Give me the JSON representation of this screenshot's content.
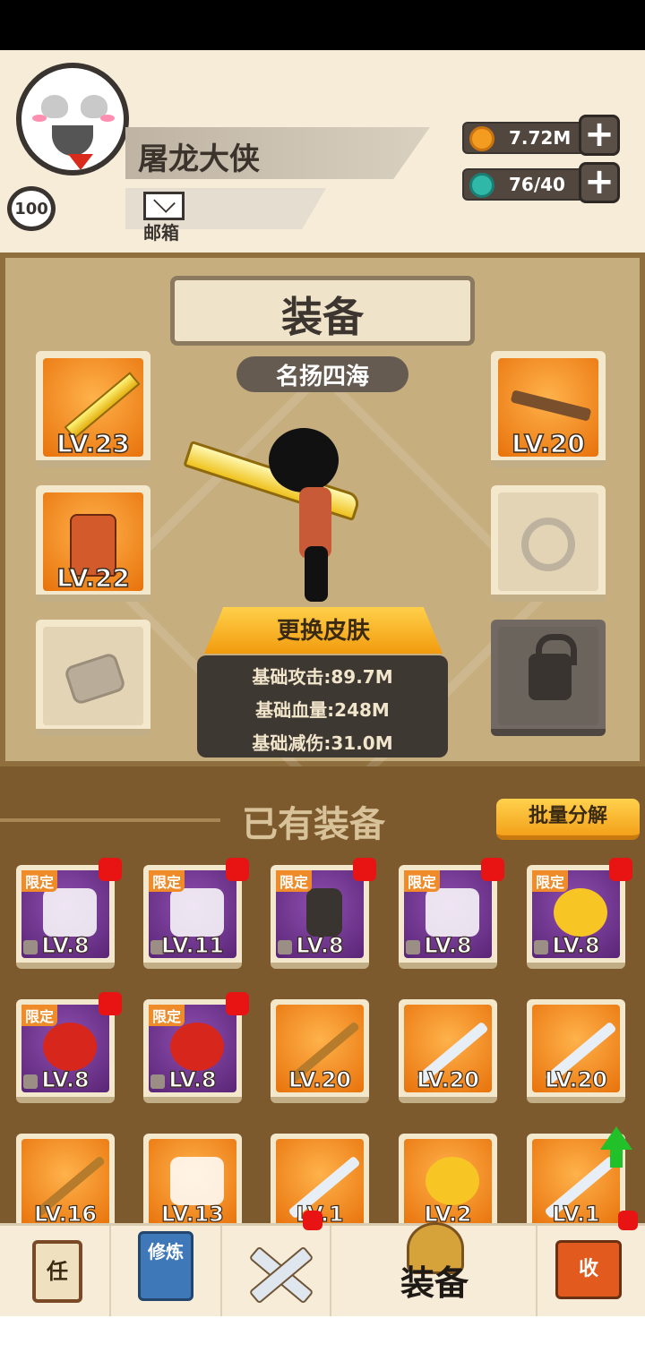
{
  "player": {
    "name": "屠龙大侠",
    "level": "100",
    "mail_label": "邮箱"
  },
  "resources": {
    "coins": "7.72M",
    "gems": "76/40",
    "plus": "+"
  },
  "equip": {
    "title": "装备",
    "subtitle": "名扬四海",
    "slots": [
      {
        "name": "weapon",
        "level": "LV.23"
      },
      {
        "name": "armor",
        "level": "LV.22"
      },
      {
        "name": "accessory",
        "level": ""
      },
      {
        "name": "hat",
        "level": "LV.20"
      },
      {
        "name": "ring",
        "level": ""
      },
      {
        "name": "locked",
        "level": ""
      }
    ],
    "skin_button": "更换皮肤",
    "stats": [
      "基础攻击:89.7M",
      "基础血量:248M",
      "基础减伤:31.0M"
    ]
  },
  "inventory": {
    "title": "已有装备",
    "batch_button": "批量分解",
    "tag_limited": "限定",
    "items": [
      {
        "level": "LV.8",
        "limited": true,
        "dot": true
      },
      {
        "level": "LV.11",
        "limited": true,
        "dot": true
      },
      {
        "level": "LV.8",
        "limited": true,
        "dot": true
      },
      {
        "level": "LV.8",
        "limited": true,
        "dot": true
      },
      {
        "level": "LV.8",
        "limited": true,
        "dot": true
      },
      {
        "level": "LV.8",
        "limited": true,
        "dot": true
      },
      {
        "level": "LV.8",
        "limited": true,
        "dot": true
      },
      {
        "level": "LV.20",
        "limited": false,
        "dot": false
      },
      {
        "level": "LV.20",
        "limited": false,
        "dot": false
      },
      {
        "level": "LV.20",
        "limited": false,
        "dot": false
      },
      {
        "level": "LV.16",
        "limited": false,
        "dot": false
      },
      {
        "level": "LV.13",
        "limited": false,
        "dot": false
      },
      {
        "level": "LV.1",
        "limited": false,
        "dot": false
      },
      {
        "level": "LV.2",
        "limited": false,
        "dot": false
      },
      {
        "level": "LV.1",
        "limited": false,
        "dot": false
      }
    ]
  },
  "navbar": {
    "task": "任",
    "cultivate": "修炼",
    "equip_label": "装备",
    "shop": "收"
  }
}
